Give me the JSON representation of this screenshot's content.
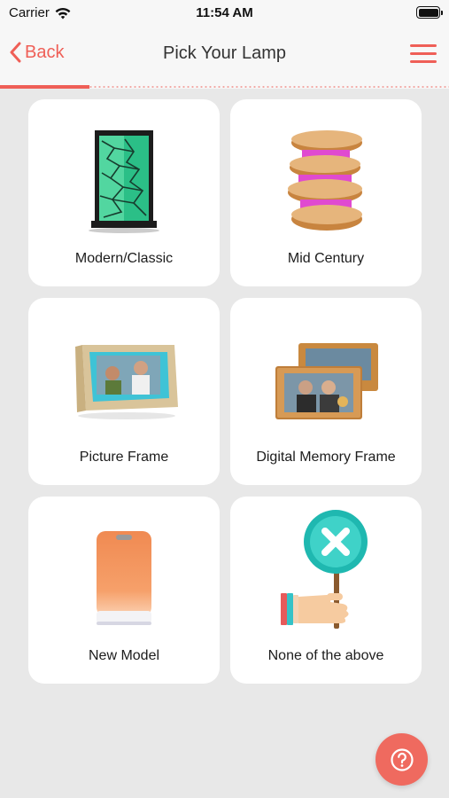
{
  "status_bar": {
    "carrier": "Carrier",
    "time": "11:54 AM"
  },
  "nav": {
    "back_label": "Back",
    "title": "Pick Your Lamp",
    "menu_icon": "hamburger-menu-icon"
  },
  "progress": {
    "fraction": 0.2
  },
  "options": [
    {
      "label": "Modern/Classic",
      "icon": "modern-classic-lamp-icon"
    },
    {
      "label": "Mid Century",
      "icon": "mid-century-lamp-icon"
    },
    {
      "label": "Picture Frame",
      "icon": "picture-frame-lamp-icon"
    },
    {
      "label": "Digital Memory Frame",
      "icon": "digital-memory-frame-icon"
    },
    {
      "label": "New Model",
      "icon": "new-model-lamp-icon"
    },
    {
      "label": "None of the above",
      "icon": "none-sign-icon"
    }
  ],
  "colors": {
    "accent": "#ef5f57",
    "background": "#e8e8e8",
    "card": "#ffffff"
  },
  "help_button": {
    "icon": "question-mark-icon"
  }
}
